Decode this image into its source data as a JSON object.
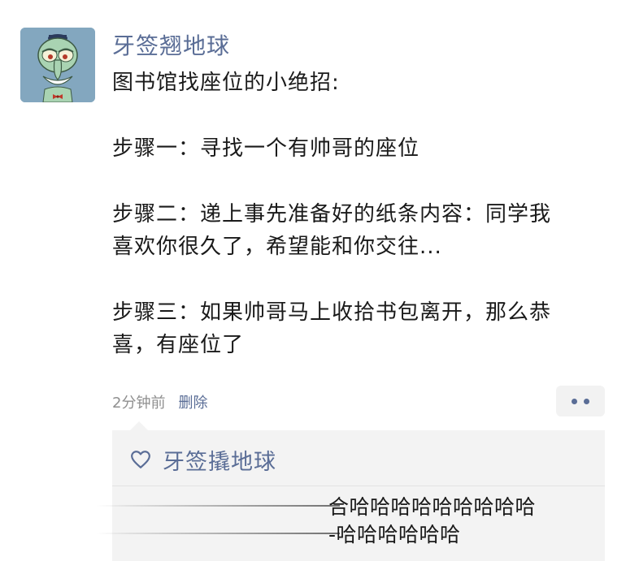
{
  "post": {
    "nickname": "牙签翘地球",
    "content": {
      "title": "图书馆找座位的小绝招:",
      "step1": "步骤一：寻找一个有帅哥的座位",
      "step2": "步骤二：递上事先准备好的纸条内容：同学我喜欢你很久了，希望能和你交往...",
      "step3": "步骤三：如果帅哥马上收拾书包离开，那么恭喜，有座位了"
    },
    "time": "2分钟前",
    "delete_label": "删除"
  },
  "interaction": {
    "liker": "牙签撬地球",
    "comment_line1": "合哈哈哈哈哈哈哈哈哈",
    "comment_line2": "-哈哈哈哈哈哈"
  },
  "icons": {
    "avatar": "squidward-avatar",
    "more": "more-dots-icon",
    "like": "heart-outline-icon"
  },
  "colors": {
    "link": "#5a6d96",
    "meta": "#8f8f8f",
    "panel": "#f3f3f3",
    "avatar_bg": "#83a7bf"
  }
}
